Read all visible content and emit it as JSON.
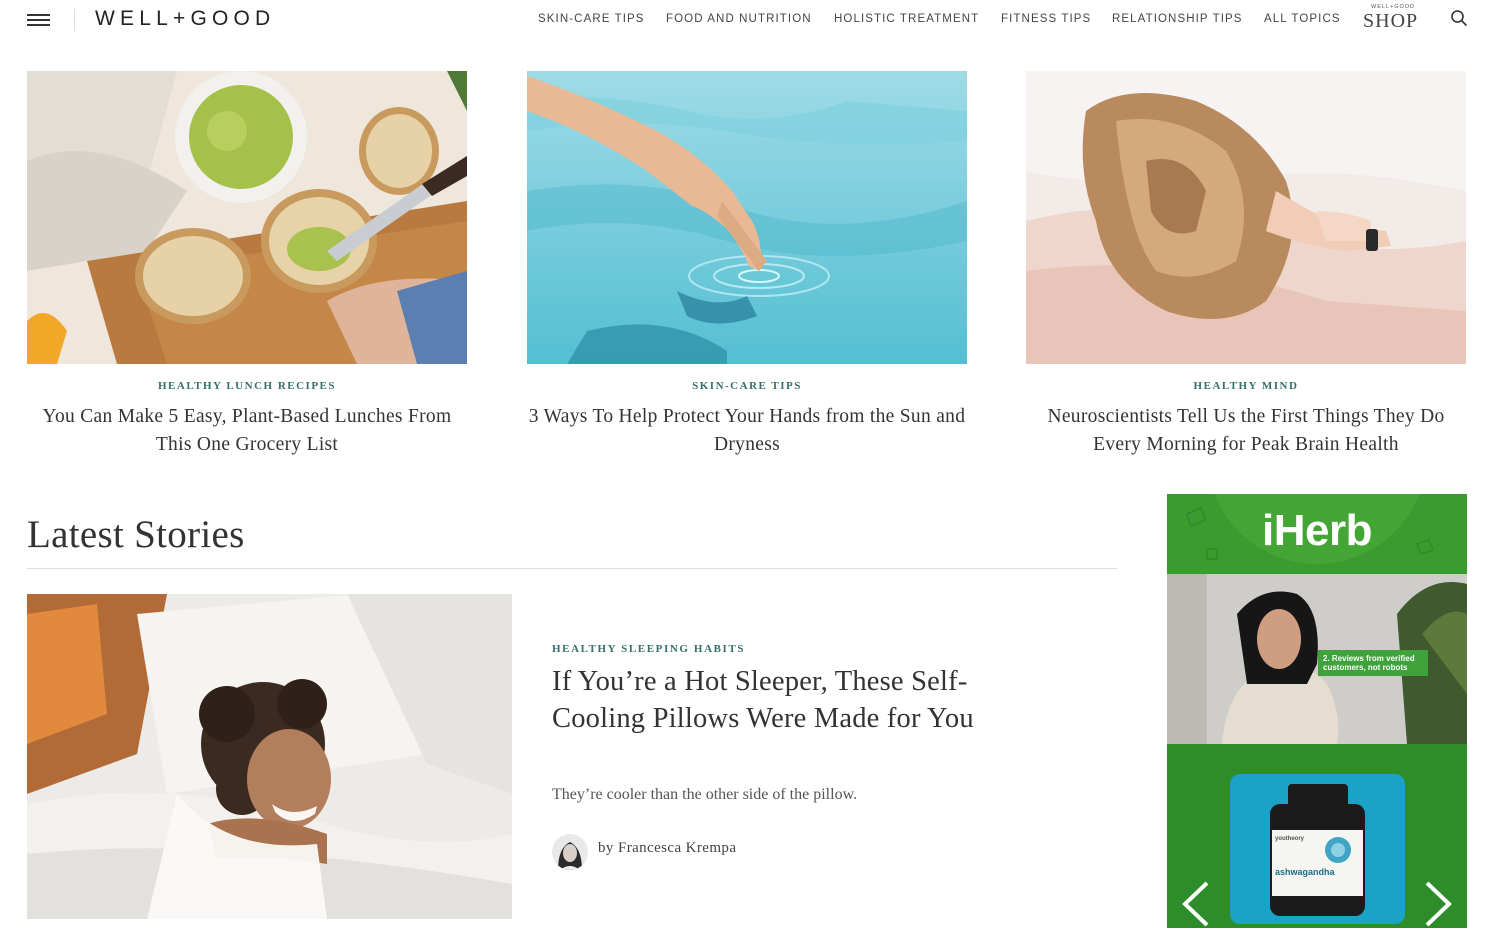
{
  "header": {
    "logo": "WELL+GOOD",
    "nav": [
      {
        "label": "SKIN-CARE TIPS"
      },
      {
        "label": "FOOD AND NUTRITION"
      },
      {
        "label": "HOLISTIC TREATMENT"
      },
      {
        "label": "FITNESS TIPS"
      },
      {
        "label": "RELATIONSHIP TIPS"
      },
      {
        "label": "ALL TOPICS"
      }
    ],
    "shop_small": "WELL+GOOD",
    "shop_big": "SHOP"
  },
  "featured": [
    {
      "category": "HEALTHY LUNCH RECIPES",
      "title": "You Can Make 5 Easy, Plant-Based Lunches From This One Grocery List"
    },
    {
      "category": "SKIN-CARE TIPS",
      "title": "3 Ways To Help Protect Your Hands from the Sun and Dryness"
    },
    {
      "category": "HEALTHY MIND",
      "title": "Neuroscientists Tell Us the First Things They Do Every Morning for Peak Brain Health"
    }
  ],
  "latest": {
    "heading": "Latest Stories",
    "story": {
      "category": "HEALTHY SLEEPING HABITS",
      "title": "If You’re a Hot Sleeper, These Self-Cooling Pillows Were Made for You",
      "dek": "They’re cooler than the other side of the pillow.",
      "byline": "by Francesca Krempa"
    }
  },
  "ad": {
    "brand": "iHerb",
    "badge": "2. Reviews from verified customers, not robots",
    "product_name": "ashwagandha",
    "product_brand": "youtheory"
  }
}
